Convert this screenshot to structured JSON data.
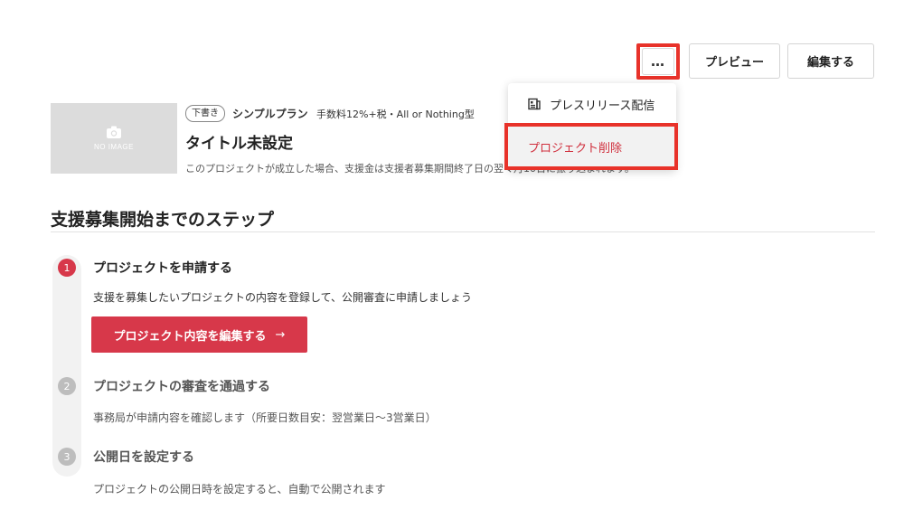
{
  "toolbar": {
    "more_label": "…",
    "preview_label": "プレビュー",
    "edit_label": "編集する"
  },
  "menu": {
    "press_release": "プレスリリース配信",
    "delete_project": "プロジェクト削除"
  },
  "project": {
    "thumbnail_text": "NO IMAGE",
    "status_badge": "下書き",
    "plan_name": "シンプルプラン",
    "fee_text": "手数料12%+税・All or Nothing型",
    "title": "タイトル未設定",
    "note": "このプロジェクトが成立した場合、支援金は支援者募集期間終了日の翌々月10日に振り込まれます。"
  },
  "steps_section": {
    "title": "支援募集開始までのステップ",
    "steps": [
      {
        "number": "1",
        "title": "プロジェクトを申請する",
        "description": "支援を募集したいプロジェクトの内容を登録して、公開審査に申請しましょう",
        "action_label": "プロジェクト内容を編集する",
        "action_arrow": "→",
        "active": true
      },
      {
        "number": "2",
        "title": "プロジェクトの審査を通過する",
        "description": "事務局が申請内容を確認します（所要日数目安：翌営業日〜3営業日）",
        "active": false
      },
      {
        "number": "3",
        "title": "公開日を設定する",
        "description": "プロジェクトの公開日時を設定すると、自動で公開されます",
        "active": false
      }
    ]
  },
  "colors": {
    "accent": "#d7384a",
    "highlight_box": "#e8322a",
    "inactive_step": "#bdbdbd"
  },
  "icons": {
    "more": "more-horizontal-icon",
    "press_release": "newspaper-icon",
    "camera": "camera-icon",
    "arrow": "arrow-right-icon"
  }
}
